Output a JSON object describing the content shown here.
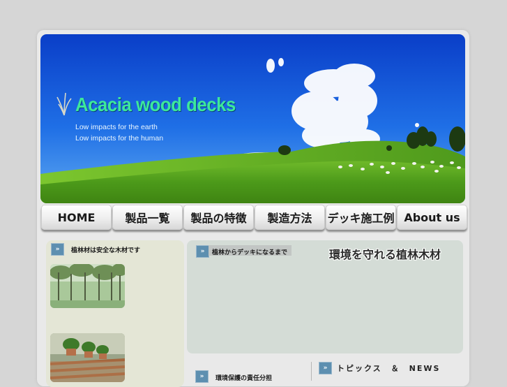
{
  "banner": {
    "title": "Acacia wood decks",
    "tagline_1": "Low impacts for the earth",
    "tagline_2": "Low impacts for the human"
  },
  "nav": {
    "items": [
      {
        "label": "HOME"
      },
      {
        "label": "製品一覧"
      },
      {
        "label": "製品の特徴"
      },
      {
        "label": "製造方法"
      },
      {
        "label": "デッキ施工例"
      },
      {
        "label": "About us"
      }
    ]
  },
  "left": {
    "section_title": "植林材は安全な木材です",
    "title_suffix": "",
    "body_text": ""
  },
  "right": {
    "section_title": "植林からデッキになるまで",
    "heading": "環境を守れる植林木材",
    "para_1": " ",
    "para_2": ""
  },
  "bottom": {
    "section_title": "環境保護の責任分担",
    "news_marker": "",
    "news_title": "トピックス　＆　NEWS"
  },
  "colors": {
    "accent_arrow": "#5d8fb0",
    "title_green": "#3de89b",
    "panel_left": "#e4e6d6",
    "panel_right": "#d4dcd6"
  }
}
